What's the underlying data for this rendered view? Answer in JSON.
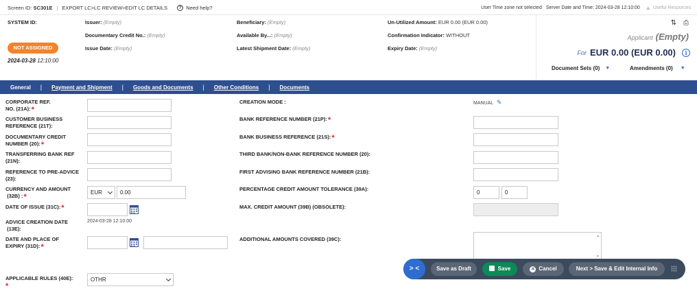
{
  "topbar": {
    "screen_id_label": "Screen ID:",
    "screen_id": "SC301E",
    "breadcrumb": "EXPORT LC>LC REVIEW>EDIT LC DETAILS",
    "help": "Need help?",
    "timezone": "User Time zone not selected",
    "server_time": "Server Date and Time: 2024-03-28 12:10:00",
    "resources": "Useful Resources"
  },
  "summary": {
    "system_id_label": "SYSTEM ID:",
    "status_badge": "NOT ASSIGNED",
    "date": "2024-03-28",
    "time": "12:10:00",
    "issuer_label": "Issuer:",
    "issuer": "(Empty)",
    "doc_credit_label": "Documentary Credit No.:",
    "doc_credit": "(Empty)",
    "issue_date_label": "Issue Date:",
    "issue_date": "(Empty)",
    "beneficiary_label": "Beneficiary:",
    "beneficiary": "(Empty)",
    "available_by_label": "Available By...:",
    "available_by": "(Empty)",
    "latest_shipment_label": "Latest Shipment Date:",
    "latest_shipment": "(Empty)",
    "unutilized_label": "Un-Utilized Amount:",
    "unutilized": "EUR 0.00 (EUR 0.00)",
    "confirmation_label": "Confirmation Indicator:",
    "confirmation": "WITHOUT",
    "expiry_label": "Expiry Date:",
    "expiry": "(Empty)",
    "applicant_label": "Applicant",
    "applicant": "(Empty)",
    "for_label": "For",
    "amount": "EUR 0.00 (EUR 0.00)",
    "document_sets": "Document Sets (0)",
    "amendments": "Amendments (0)"
  },
  "tabs": [
    "General",
    "Payment and Shipment",
    "Goods and Documents",
    "Other Conditions",
    "Documents"
  ],
  "form": {
    "corp_ref_1": "CORPORATE REF.",
    "corp_ref_2": "NO. (21A):",
    "cust_ref_1": "CUSTOMER BUSINESS",
    "cust_ref_2": "REFERENCE (21T):",
    "doc_credit_1": "DOCUMENTARY CREDIT",
    "doc_credit_2": "NUMBER (20):",
    "transfer_1": "TRANSFERRING BANK REF",
    "transfer_2": "(21N):",
    "preadvice_1": "REFERENCE TO PRE-ADVICE",
    "preadvice_2": "(23):",
    "currency_1": "CURRENCY AND AMOUNT",
    "currency_2": "(32B) :",
    "currency": "EUR",
    "amount": "0.00",
    "date_issue": "DATE OF ISSUE  (31C):",
    "advice_1": "ADVICE CREATION DATE",
    "advice_2": "(13E):",
    "advice_value": "2024-03-28 12:10:00",
    "expiry_1": "DATE AND PLACE OF",
    "expiry_2": "EXPIRY  (31D):",
    "rules": "APPLICABLE RULES  (40E):",
    "rules_value": "OTHR",
    "creation_mode": "CREATION MODE :",
    "creation_mode_value": "MANUAL",
    "bank_ref": "BANK REFERENCE NUMBER (21P):",
    "bank_business": "BANK BUSINESS REFERENCE (21S):",
    "third_bank": "THIRD BANK/NON-BANK REFERENCE NUMBER  (20):",
    "first_advising": "FIRST ADVISING BANK REFERENCE NUMBER  (21B):",
    "tolerance": "PERCENTAGE CREDIT AMOUNT TOLERANCE  (39A):",
    "tolerance_plus": "0",
    "tolerance_minus": "0",
    "max_credit": "MAX. CREDIT AMOUNT  (39B) (OBSOLETE):",
    "additional": "ADDITIONAL AMOUNTS COVERED  (39C):"
  },
  "actions": {
    "expand": "> <",
    "save_draft": "Save as Draft",
    "save": "Save",
    "cancel": "Cancel",
    "next": "Next > Save & Edit Internal Info"
  },
  "colors": {
    "tab_bar": "#2e4f8f",
    "badge": "#f4832a",
    "required": "#e0252b",
    "save_button": "#0c8a57",
    "action_bar": "#3b4a5d",
    "accent": "#2f6dd0"
  }
}
